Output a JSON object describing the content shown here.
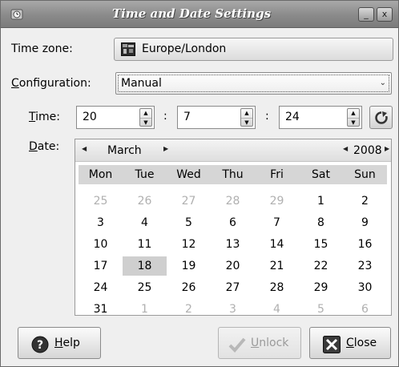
{
  "window": {
    "title": "Time and Date Settings",
    "minimize_glyph": "_",
    "close_glyph": "x"
  },
  "timezone": {
    "label": "Time zone:",
    "value": "Europe/London"
  },
  "configuration": {
    "label_accel": "C",
    "label_rest": "onfiguration:",
    "value": "Manual",
    "arrow": "⌄"
  },
  "time": {
    "label_accel": "T",
    "label_rest": "ime:",
    "hours": "20",
    "minutes": "7",
    "seconds": "24",
    "separator": ":"
  },
  "date": {
    "label_accel": "D",
    "label_rest": "ate:",
    "month": "March",
    "year": "2008",
    "weekdays": [
      "Mon",
      "Tue",
      "Wed",
      "Thu",
      "Fri",
      "Sat",
      "Sun"
    ],
    "weeks": [
      [
        {
          "d": "25",
          "o": true
        },
        {
          "d": "26",
          "o": true
        },
        {
          "d": "27",
          "o": true
        },
        {
          "d": "28",
          "o": true
        },
        {
          "d": "29",
          "o": true
        },
        {
          "d": "1"
        },
        {
          "d": "2"
        }
      ],
      [
        {
          "d": "3"
        },
        {
          "d": "4"
        },
        {
          "d": "5"
        },
        {
          "d": "6"
        },
        {
          "d": "7"
        },
        {
          "d": "8"
        },
        {
          "d": "9"
        }
      ],
      [
        {
          "d": "10"
        },
        {
          "d": "11"
        },
        {
          "d": "12"
        },
        {
          "d": "13"
        },
        {
          "d": "14"
        },
        {
          "d": "15"
        },
        {
          "d": "16"
        }
      ],
      [
        {
          "d": "17"
        },
        {
          "d": "18",
          "sel": true
        },
        {
          "d": "19"
        },
        {
          "d": "20"
        },
        {
          "d": "21"
        },
        {
          "d": "22"
        },
        {
          "d": "23"
        }
      ],
      [
        {
          "d": "24"
        },
        {
          "d": "25"
        },
        {
          "d": "26"
        },
        {
          "d": "27"
        },
        {
          "d": "28"
        },
        {
          "d": "29"
        },
        {
          "d": "30"
        }
      ],
      [
        {
          "d": "31"
        },
        {
          "d": "1",
          "o": true
        },
        {
          "d": "2",
          "o": true
        },
        {
          "d": "3",
          "o": true
        },
        {
          "d": "4",
          "o": true
        },
        {
          "d": "5",
          "o": true
        },
        {
          "d": "6",
          "o": true
        }
      ]
    ]
  },
  "buttons": {
    "help_accel": "H",
    "help_rest": "elp",
    "unlock_accel": "U",
    "unlock_rest": "nlock",
    "close_accel": "C",
    "close_rest": "lose"
  }
}
